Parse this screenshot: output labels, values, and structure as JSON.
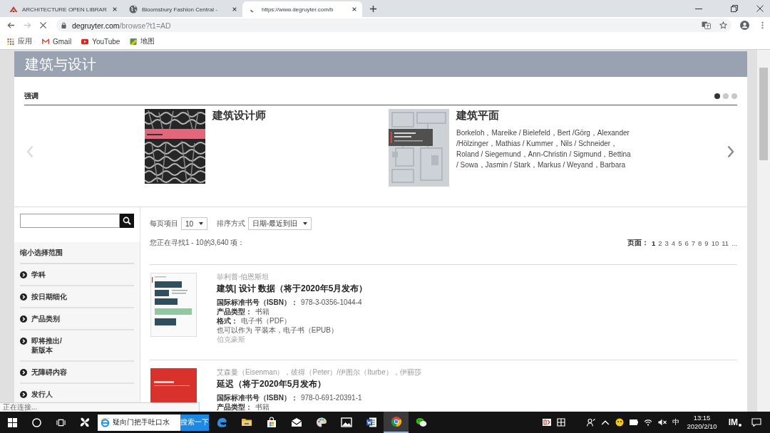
{
  "browser": {
    "tabs": [
      {
        "title": "ARCHITECTURE OPEN LIBRAR",
        "kind": "logo",
        "selected": false
      },
      {
        "title": "Bloomsbury Fashion Central -",
        "kind": "globe",
        "selected": false
      },
      {
        "title": "https://www.degruyter.com/b",
        "kind": "loading",
        "selected": true
      }
    ],
    "forward_disabled": true,
    "address": {
      "host": "degruyter.com",
      "path": "/browse?t1=AD"
    },
    "bookmarks": [
      {
        "label": "应用",
        "kind": "apps"
      },
      {
        "label": "Gmail",
        "kind": "gmail"
      },
      {
        "label": "YouTube",
        "kind": "youtube"
      },
      {
        "label": "地图",
        "kind": "maps"
      }
    ]
  },
  "page": {
    "heading": "建筑与设计",
    "highlights": {
      "label": "强调",
      "dots": [
        {
          "selected": true
        },
        {
          "selected": false
        },
        {
          "selected": false
        }
      ],
      "prev_disabled": true,
      "next_disabled": false,
      "items": [
        {
          "title": "建筑设计师",
          "kind": "texture"
        },
        {
          "title": "建筑平面",
          "kind": "plan",
          "authors": "Borkeloh，Mareike / Bielefeld，Bert /Görg，Alexander /Hölzinger，Mathias / Kummer，Nils / Schneider，Roland / Siegemund，Ann-Christin / Sigmund，Bettina / Sowa，Jasmin / Stark，Markus / Weyand，Barbara"
        }
      ]
    },
    "sidebar": {
      "title": "缩小选择范围",
      "items": [
        {
          "label": "学科"
        },
        {
          "label": "按日期细化"
        },
        {
          "label": "产品类别"
        },
        {
          "label": "即将推出/\n新版本"
        },
        {
          "label": "无障碍内容"
        },
        {
          "label": "发行人"
        }
      ]
    },
    "controls": {
      "per_page": {
        "label": "每页项目",
        "value": "10"
      },
      "sort": {
        "label": "排序方式",
        "value": "日期-最近到旧"
      }
    },
    "result_count": "您正在寻找1 - 10的3,640 项：",
    "pagination": {
      "label": "页面：",
      "pages": [
        {
          "label": "1",
          "selected": true
        },
        {
          "label": "2",
          "selected": false
        },
        {
          "label": "3",
          "selected": false
        },
        {
          "label": "4",
          "selected": false
        },
        {
          "label": "5",
          "selected": false
        },
        {
          "label": "6",
          "selected": false
        },
        {
          "label": "7",
          "selected": false
        },
        {
          "label": "8",
          "selected": false
        },
        {
          "label": "9",
          "selected": false
        },
        {
          "label": "10",
          "selected": false
        },
        {
          "label": "11",
          "selected": false
        }
      ],
      "more": "..."
    },
    "results": [
      {
        "kind": "typographic",
        "authors": "菲利普·伯恩斯坦",
        "title": "建筑| 设计 数据（将于2020年5月发布）",
        "fields": [
          {
            "label": "国际标准书号（ISBN）：",
            "value": "978-3-0356-1044-4"
          },
          {
            "label": "产品类型：",
            "value": "书籍"
          },
          {
            "label": "格式：",
            "value": "电子书（PDF）"
          }
        ],
        "also": "也可以作为 平装本，电子书（EPUB）",
        "publisher": "伯克豪斯"
      },
      {
        "kind": "solid",
        "authors": "艾森曼（Eisenman），彼得（Peter）/伊图尔（Iturbe），伊丽莎",
        "title": "延迟（将于2020年5月发布）",
        "fields": [
          {
            "label": "国际标准书号（ISBN）：",
            "value": "978-0-691-20391-1"
          },
          {
            "label": "产品类型：",
            "value": "书籍"
          }
        ]
      }
    ]
  },
  "status": "正在连接...",
  "taskbar": {
    "search": {
      "value": "疑向门把手吐口水",
      "button": "搜索一下"
    },
    "apps": [
      {
        "kind": "edge",
        "selected": false
      },
      {
        "kind": "folder",
        "selected": false
      },
      {
        "kind": "store",
        "selected": false
      },
      {
        "kind": "mail",
        "selected": false
      },
      {
        "kind": "paint",
        "selected": false
      },
      {
        "kind": "photos",
        "selected": false
      },
      {
        "kind": "word",
        "selected": false
      },
      {
        "kind": "chrome",
        "selected": true
      },
      {
        "kind": "wechat",
        "selected": false
      }
    ],
    "ime": "中",
    "time": "13:15",
    "date": "2020/2/10",
    "tray_label": "IM"
  }
}
